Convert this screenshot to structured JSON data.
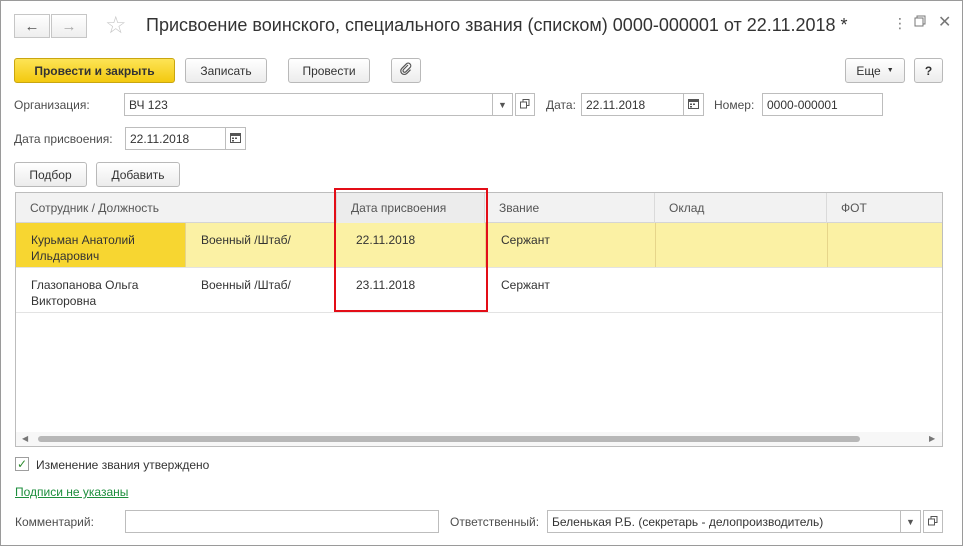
{
  "window": {
    "title": "Присвоение воинского, специального звания (списком) 0000-000001 от 22.11.2018 *",
    "back_icon": "arrow-left-icon",
    "forward_icon": "arrow-right-icon",
    "favorite_icon": "star-icon",
    "menu_icon": "more-vertical-icon",
    "restore_icon": "restore-window-icon",
    "close_icon": "close-icon"
  },
  "toolbar": {
    "post_close_label": "Провести и закрыть",
    "save_label": "Записать",
    "post_label": "Провести",
    "attach_icon": "paperclip-icon",
    "more_label": "Еще",
    "help_label": "?"
  },
  "form": {
    "organization_label": "Организация:",
    "organization_value": "ВЧ 123",
    "date_label": "Дата:",
    "date_value": "22.11.2018",
    "number_label": "Номер:",
    "number_value": "0000-000001",
    "assign_date_label": "Дата присвоения:",
    "assign_date_value": "22.11.2018"
  },
  "table_toolbar": {
    "select_label": "Подбор",
    "add_label": "Добавить"
  },
  "table": {
    "columns": [
      "Сотрудник / Должность",
      "Дата присвоения",
      "Звание",
      "Оклад",
      "ФОТ"
    ],
    "rows": [
      {
        "employee": "Курьман Анатолий Ильдарович",
        "position": "Военный /Штаб/",
        "date": "22.11.2018",
        "rank": "Сержант",
        "salary": "",
        "fot": ""
      },
      {
        "employee": "Глазопанова Ольга Викторовна",
        "position": "Военный /Штаб/",
        "date": "23.11.2018",
        "rank": "Сержант",
        "salary": "",
        "fot": ""
      }
    ]
  },
  "footer": {
    "approved_label": "Изменение звания утверждено",
    "approved_checked": true,
    "signatures_link": "Подписи не указаны",
    "comment_label": "Комментарий:",
    "comment_value": "",
    "responsible_label": "Ответственный:",
    "responsible_value": "Беленькая Р.Б. (секретарь - делопроизводитель)"
  },
  "colors": {
    "accent_button": "#f3c90f",
    "selected_row": "#fbf1a4",
    "selected_cell": "#f7d631",
    "highlight_box": "#e30d17",
    "link": "#1c8e3c"
  }
}
